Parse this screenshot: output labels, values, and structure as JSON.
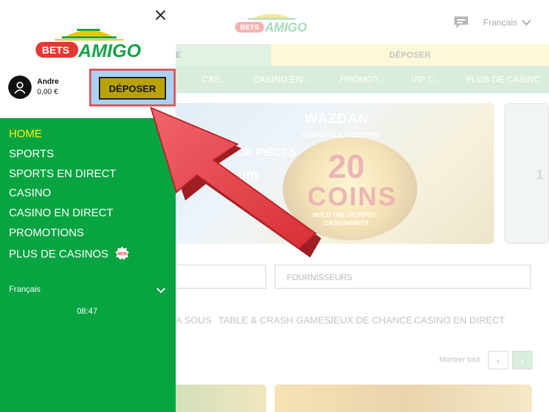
{
  "header": {
    "brand": "BETS AMIGO",
    "language": "Français"
  },
  "actions": {
    "login_label": "E",
    "deposit_label": "DÉPOSER"
  },
  "nav": {
    "items": [
      "CAS...",
      "CASINO EN ...",
      "PROMOT...",
      "VIP C...",
      "PLUS DE CASINC"
    ]
  },
  "banner": {
    "provider": "WAZDAN",
    "subtitle": "DE PIÈCES",
    "subtitle2": "um",
    "game_edition": "GRAND GOLD EDITION",
    "game_number": "20",
    "game_word": "COINS",
    "tagline1": "HOLD THE JACKPOT",
    "tagline2": "CASH INFINITY",
    "side_char": "1"
  },
  "filters": {
    "providers_placeholder": "FOURNISSEURS"
  },
  "categories": [
    "A SOUS",
    "TABLE & CRASH GAMES",
    "JEUX DE CHANCE",
    "CASINO EN DIRECT"
  ],
  "section": {
    "show_all": "Montrer tout",
    "prev": "‹",
    "next": "›"
  },
  "drawer": {
    "user_name": "Andre",
    "balance": "0,00 €",
    "deposit_button": "DÉPOSER",
    "menu": [
      {
        "label": "HOME",
        "active": true
      },
      {
        "label": "SPORTS"
      },
      {
        "label": "SPORTS EN DIRECT"
      },
      {
        "label": "CASINO"
      },
      {
        "label": "CASINO EN DIRECT"
      },
      {
        "label": "PROMOTIONS"
      },
      {
        "label": "PLUS DE CASINOS",
        "badge": "NEW"
      }
    ],
    "language": "Français",
    "time": "08:47"
  },
  "colors": {
    "drawer_green": "#08a441",
    "active_item": "#fff200",
    "deposit_button": "#b9a208",
    "highlight_border": "#e0565c",
    "highlight_fill": "#a9d1f2",
    "arrow_red": "#e23a40"
  }
}
